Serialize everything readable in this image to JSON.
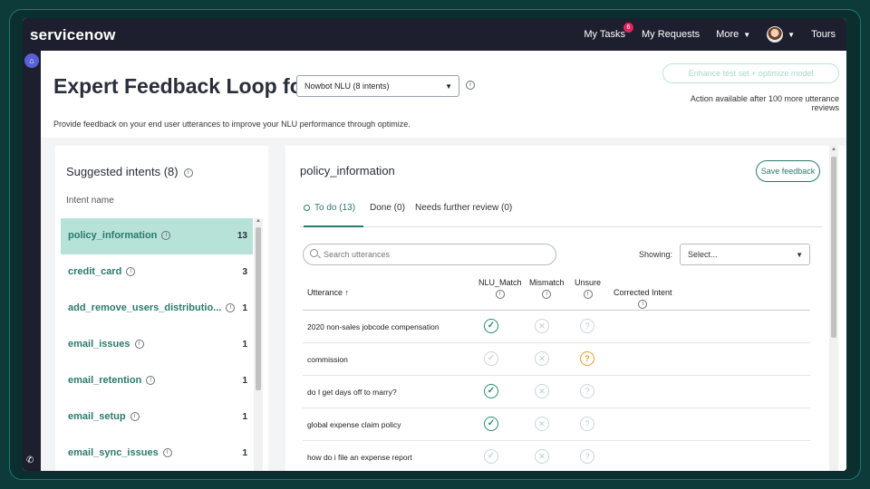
{
  "nav": {
    "brand": "servicenow",
    "my_tasks": "My Tasks",
    "my_tasks_badge": "6",
    "my_requests": "My Requests",
    "more": "More",
    "tours": "Tours"
  },
  "header": {
    "title": "Expert Feedback Loop for",
    "model_select": "Nowbot NLU (8 intents)",
    "enhance_button": "Enhance test set + optimize model",
    "action_note": "Action available after 100 more utterance reviews",
    "subtitle": "Provide feedback on your end user utterances to improve your NLU performance through optimize."
  },
  "intents": {
    "title": "Suggested intents (8)",
    "column_header": "Intent name",
    "items": [
      {
        "name": "policy_information",
        "count": "13"
      },
      {
        "name": "credit_card",
        "count": "3"
      },
      {
        "name": "add_remove_users_distributio...",
        "count": "1"
      },
      {
        "name": "email_issues",
        "count": "1"
      },
      {
        "name": "email_retention",
        "count": "1"
      },
      {
        "name": "email_setup",
        "count": "1"
      },
      {
        "name": "email_sync_issues",
        "count": "1"
      }
    ]
  },
  "detail": {
    "title": "policy_information",
    "save_button": "Save feedback",
    "tabs": [
      "To do (13)",
      "Done (0)",
      "Needs further review (0)"
    ],
    "search_placeholder": "Search utterances",
    "showing_label": "Showing:",
    "showing_select": "Select...",
    "columns": {
      "utterance": "Utterance ↑",
      "nlu_match": "NLU_Match",
      "mismatch": "Mismatch",
      "unsure": "Unsure",
      "corrected": "Corrected Intent"
    },
    "rows": [
      {
        "utterance": "2020 non-sales jobcode compensation",
        "state": "match"
      },
      {
        "utterance": "commission",
        "state": "unsure"
      },
      {
        "utterance": "do I get days off to marry?",
        "state": "match"
      },
      {
        "utterance": "global expense claim policy",
        "state": "match"
      },
      {
        "utterance": "how do i file an expense report",
        "state": "none"
      }
    ]
  },
  "colors": {
    "accent": "#2b7a6c",
    "selected_row": "#b7e2d8",
    "unsure": "#e19a2c",
    "nav_bg": "#1d1f2e"
  }
}
